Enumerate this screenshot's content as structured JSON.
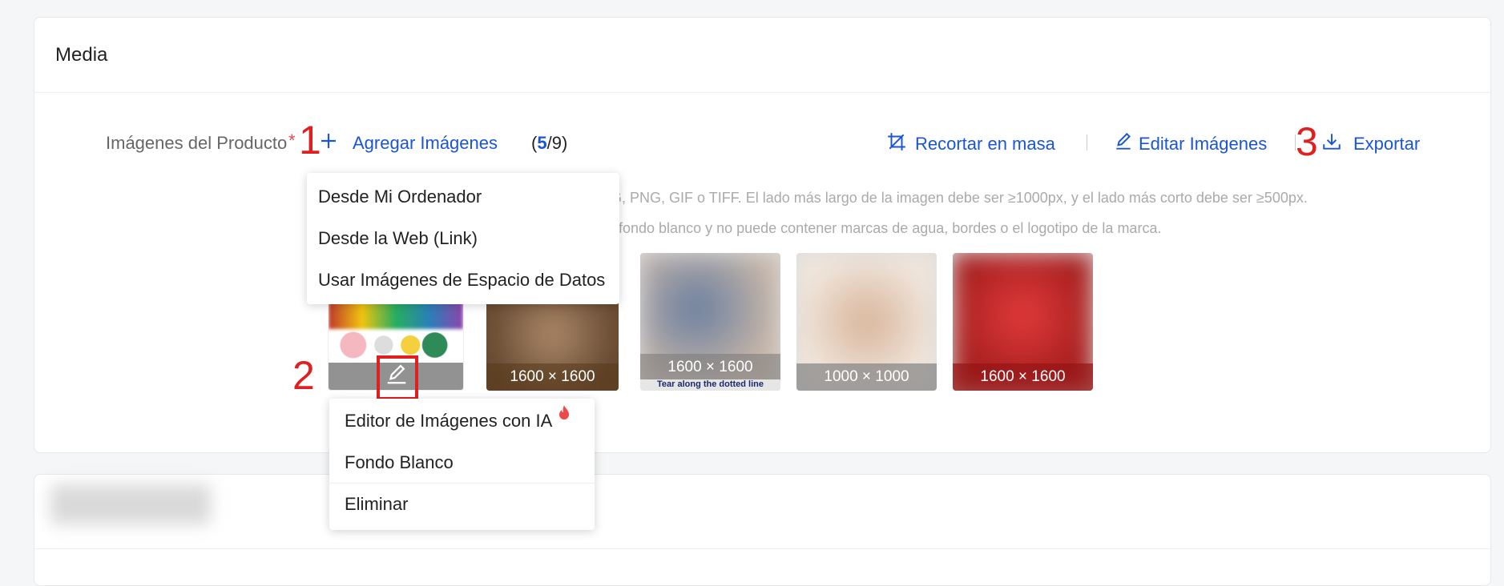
{
  "card": {
    "title": "Media"
  },
  "field": {
    "label": "Imágenes del Producto",
    "required_mark": "*"
  },
  "annotations": {
    "one": "1",
    "two": "2",
    "three": "3"
  },
  "toolbar": {
    "add_images": "Agregar Imágenes",
    "count_current": "5",
    "count_total": "9",
    "bulk_crop": "Recortar en masa",
    "edit_images": "Editar Imágenes",
    "export": "Exportar"
  },
  "hints": {
    "line1": "G, PNG, GIF o TIFF. El lado más largo de la imagen debe ser ≥1000px, y el lado más corto debe ser ≥500px.",
    "line2": "fondo blanco y no puede contener marcas de agua, bordes o el logotipo de la marca."
  },
  "add_menu": {
    "items": [
      "Desde Mi Ordenador",
      "Desde la Web (Link)",
      "Usar Imágenes de Espacio de Datos"
    ]
  },
  "image_menu": {
    "items": [
      "Editor de Imágenes con IA",
      "Fondo Blanco",
      "Eliminar"
    ]
  },
  "images": [
    {
      "dims": ""
    },
    {
      "dims": "1600 × 1600"
    },
    {
      "dims": "1600 × 1600",
      "caption": "Tear along the dotted line"
    },
    {
      "dims": "1000 × 1000"
    },
    {
      "dims": "1600 × 1600"
    }
  ],
  "colors": {
    "link": "#1a55d8",
    "annotation": "#e02020",
    "required": "#e5484d"
  }
}
